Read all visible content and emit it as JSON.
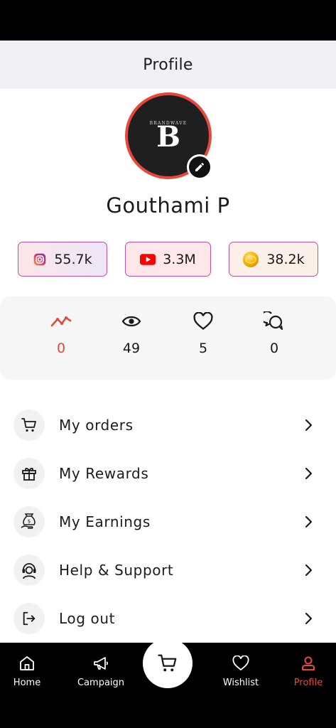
{
  "header": {
    "title": "Profile"
  },
  "avatar": {
    "brand_top": "BRANDWAVE",
    "brand_letter": "B"
  },
  "user": {
    "name": "Gouthami P"
  },
  "social": [
    {
      "platform": "instagram-icon",
      "value": "55.7k"
    },
    {
      "platform": "youtube-icon",
      "value": "3.3M"
    },
    {
      "platform": "coin-icon",
      "value": "38.2k"
    }
  ],
  "stats": [
    {
      "icon": "trend-icon",
      "value": "0",
      "color": "#e8473c"
    },
    {
      "icon": "eye-icon",
      "value": "49"
    },
    {
      "icon": "heart-icon",
      "value": "5"
    },
    {
      "icon": "chat-icon",
      "value": "0"
    }
  ],
  "menu": [
    {
      "icon": "cart-icon",
      "label": "My orders"
    },
    {
      "icon": "gift-icon",
      "label": "My Rewards"
    },
    {
      "icon": "money-bag-icon",
      "label": "My Earnings"
    },
    {
      "icon": "support-agent-icon",
      "label": "Help & Support"
    },
    {
      "icon": "logout-icon",
      "label": "Log out"
    }
  ],
  "nav": [
    {
      "icon": "home-icon",
      "label": "Home"
    },
    {
      "icon": "megaphone-icon",
      "label": "Campaign"
    },
    {
      "icon": "cart-icon",
      "label": ""
    },
    {
      "icon": "heart-icon",
      "label": "Wishlist"
    },
    {
      "icon": "user-icon",
      "label": "Profile",
      "active": true
    }
  ],
  "colors": {
    "accent": "#e8473c",
    "chip_border": "#c04fa3",
    "nav_bg": "#000000",
    "header_bg": "#f1f1f5"
  }
}
